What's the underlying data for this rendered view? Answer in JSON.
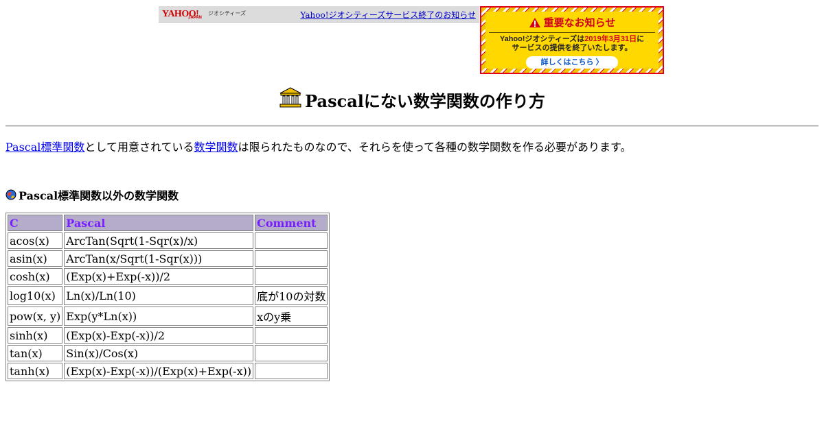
{
  "yahoo_bar": {
    "logo_text": "YAHOO!",
    "logo_sub": "JAPAN",
    "service_name": "ジオシティーズ",
    "link_text": "Yahoo!ジオシティーズサービス終了のお知らせ"
  },
  "notice": {
    "title": "重要なお知らせ",
    "line1_pre": "Yahoo!ジオシティーズは",
    "line1_date": "2019年3月31日",
    "line1_post": "に",
    "line2": "サービスの提供を終了いたします。",
    "button": "詳しくはこちら 〉",
    "colors": {
      "red": "#d0001a",
      "yellow": "#ffd800"
    }
  },
  "page": {
    "title": "Pascalにない数学関数の作り方",
    "title_icon": "temple-icon",
    "intro": {
      "link1": "Pascal標準関数",
      "text1": "として用意されている",
      "link2": "数学関数",
      "text2": "は限られたものなので、それらを使って各種の数学関数を作る必要があります。"
    },
    "section_title": "Pascal標準関数以外の数学関数",
    "section_icon": "globe-icon"
  },
  "table": {
    "headers": [
      "C",
      "Pascal",
      "Comment"
    ],
    "rows": [
      [
        "acos(x)",
        "ArcTan(Sqrt(1-Sqr(x)/x)",
        ""
      ],
      [
        "asin(x)",
        "ArcTan(x/Sqrt(1-Sqr(x)))",
        ""
      ],
      [
        "cosh(x)",
        "(Exp(x)+Exp(-x))/2",
        ""
      ],
      [
        "log10(x)",
        "Ln(x)/Ln(10)",
        "底が10の対数"
      ],
      [
        "pow(x, y)",
        "Exp(y*Ln(x))",
        "xのy乗"
      ],
      [
        "sinh(x)",
        "(Exp(x)-Exp(-x))/2",
        ""
      ],
      [
        "tan(x)",
        "Sin(x)/Cos(x)",
        ""
      ],
      [
        "tanh(x)",
        "(Exp(x)-Exp(-x))/(Exp(x)+Exp(-x))",
        ""
      ]
    ]
  }
}
